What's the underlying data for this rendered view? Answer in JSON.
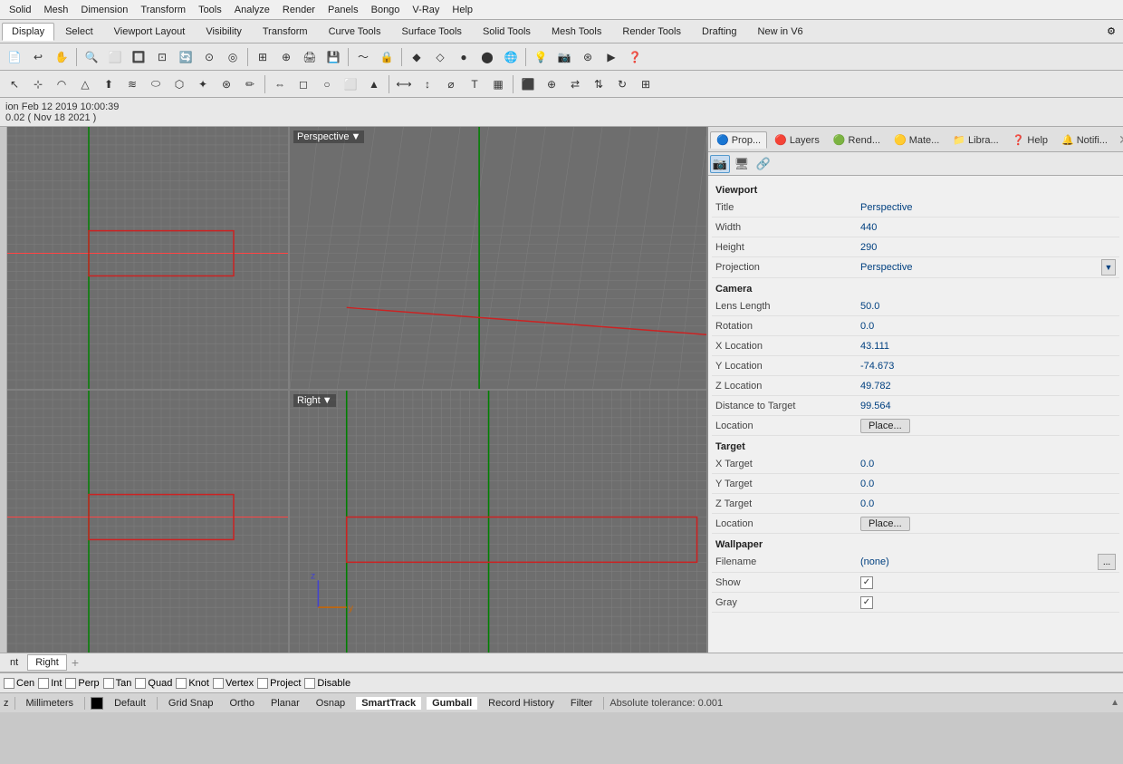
{
  "menu": {
    "items": [
      "Solid",
      "Mesh",
      "Dimension",
      "Transform",
      "Tools",
      "Analyze",
      "Render",
      "Panels",
      "Bongo",
      "V-Ray",
      "Help"
    ]
  },
  "toolbar_tabs": {
    "items": [
      "Display",
      "Select",
      "Viewport Layout",
      "Visibility",
      "Transform",
      "Curve Tools",
      "Surface Tools",
      "Solid Tools",
      "Mesh Tools",
      "Render Tools",
      "Drafting",
      "New in V6"
    ],
    "active": "Display"
  },
  "status_info": {
    "line1": "ion Feb 12 2019 10:00:39",
    "line2": "0.02 ( Nov 18 2021 )"
  },
  "viewports": [
    {
      "id": "top-left",
      "label": ""
    },
    {
      "id": "top-right",
      "label": "Perspective",
      "has_menu": true
    },
    {
      "id": "bottom-left",
      "label": ""
    },
    {
      "id": "bottom-right",
      "label": "Right",
      "has_menu": true
    }
  ],
  "right_panel": {
    "tabs": [
      "Prop...",
      "Layers",
      "Rend...",
      "Mate...",
      "Libra...",
      "Help",
      "Notifi..."
    ],
    "active_tab": "Prop...",
    "toolbar_buttons": [
      "camera-icon",
      "screen-icon",
      "link-icon"
    ]
  },
  "properties": {
    "viewport_section": "Viewport",
    "viewport_props": [
      {
        "label": "Title",
        "value": "Perspective",
        "type": "text"
      },
      {
        "label": "Width",
        "value": "440",
        "type": "text"
      },
      {
        "label": "Height",
        "value": "290",
        "type": "text"
      },
      {
        "label": "Projection",
        "value": "Perspective",
        "type": "dropdown"
      }
    ],
    "camera_section": "Camera",
    "camera_props": [
      {
        "label": "Lens Length",
        "value": "50.0",
        "type": "text"
      },
      {
        "label": "Rotation",
        "value": "0.0",
        "type": "text"
      },
      {
        "label": "X Location",
        "value": "43.111",
        "type": "text"
      },
      {
        "label": "Y Location",
        "value": "-74.673",
        "type": "text"
      },
      {
        "label": "Z Location",
        "value": "49.782",
        "type": "text"
      },
      {
        "label": "Distance to Target",
        "value": "99.564",
        "type": "text"
      },
      {
        "label": "Location",
        "value": "Place...",
        "type": "button"
      }
    ],
    "target_section": "Target",
    "target_props": [
      {
        "label": "X Target",
        "value": "0.0",
        "type": "text"
      },
      {
        "label": "Y Target",
        "value": "0.0",
        "type": "text"
      },
      {
        "label": "Z Target",
        "value": "0.0",
        "type": "text"
      },
      {
        "label": "Location",
        "value": "Place...",
        "type": "button"
      }
    ],
    "wallpaper_section": "Wallpaper",
    "wallpaper_props": [
      {
        "label": "Filename",
        "value": "(none)",
        "type": "text-browse"
      },
      {
        "label": "Show",
        "value": "checked",
        "type": "checkbox"
      },
      {
        "label": "Gray",
        "value": "checked",
        "type": "checkbox"
      }
    ]
  },
  "bottom_tabs": {
    "tabs": [
      "nt",
      "Right"
    ],
    "active": "Right"
  },
  "snap_bar": {
    "items": [
      "Cen",
      "Int",
      "Perp",
      "Tan",
      "Quad",
      "Knot",
      "Vertex",
      "Project",
      "Disable"
    ]
  },
  "status_bar": {
    "coord_label": "z",
    "unit": "Millimeters",
    "layer": "Default",
    "grid_snap": "Grid Snap",
    "ortho": "Ortho",
    "planar": "Planar",
    "osnap": "Osnap",
    "smarttrack": "SmartTrack",
    "gumball": "Gumball",
    "record_history": "Record History",
    "filter": "Filter",
    "tolerance": "Absolute tolerance: 0.001"
  }
}
